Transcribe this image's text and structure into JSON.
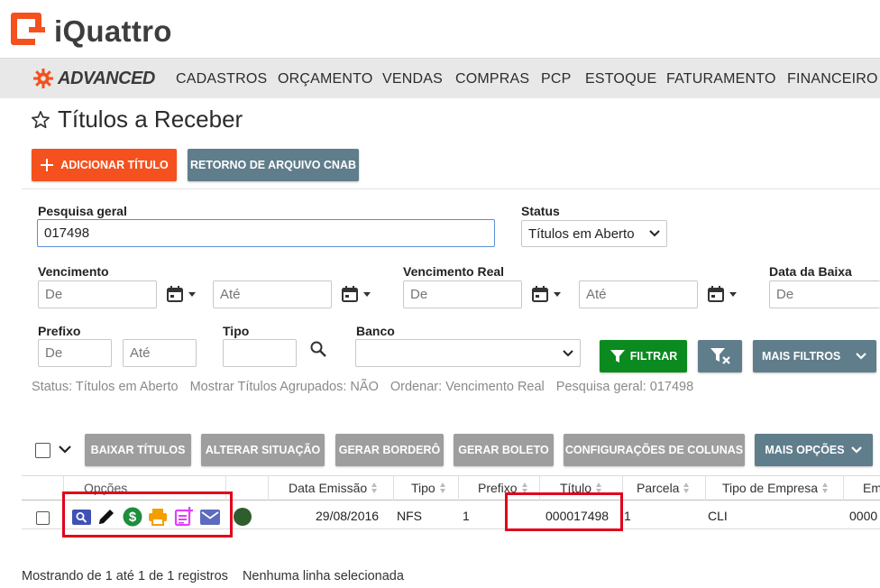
{
  "brand": {
    "name": "iQuattro",
    "edition": "ADVANCED",
    "accent": "#f4511e"
  },
  "menu": [
    "CADASTROS",
    "ORÇAMENTO",
    "VENDAS",
    "COMPRAS",
    "PCP",
    "ESTOQUE",
    "FATURAMENTO",
    "FINANCEIRO"
  ],
  "page_title": "Títulos a Receber",
  "actions": {
    "add_label": "ADICIONAR TÍTULO",
    "cnab_label": "RETORNO DE ARQUIVO CNAB"
  },
  "filters": {
    "search_label": "Pesquisa geral",
    "search_value": "017498",
    "status_label": "Status",
    "status_value": "Títulos em Aberto",
    "vencimento_label": "Vencimento",
    "vencimento_real_label": "Vencimento Real",
    "data_baixa_label": "Data da Baixa",
    "prefixo_label": "Prefixo",
    "tipo_label": "Tipo",
    "banco_label": "Banco",
    "from_placeholder": "De",
    "to_placeholder": "Até",
    "filter_button": "FILTRAR",
    "more_filters_button": "MAIS FILTROS"
  },
  "summary": {
    "status": "Status: Títulos em Aberto",
    "agrupados": "Mostrar Títulos Agrupados: NÃO",
    "ordenar": "Ordenar: Vencimento Real",
    "pesquisa": "Pesquisa geral: 017498"
  },
  "toolbar": {
    "baixar": "BAIXAR TÍTULOS",
    "alterar": "ALTERAR SITUAÇÃO",
    "bordero": "GERAR BORDERÔ",
    "boleto": "GERAR BOLETO",
    "colunas": "CONFIGURAÇÕES DE COLUNAS",
    "mais_opcoes": "MAIS OPÇÕES"
  },
  "table": {
    "headers": {
      "opcoes": "Opções",
      "data_emissao": "Data Emissão",
      "tipo": "Tipo",
      "prefixo": "Prefixo",
      "titulo": "Título",
      "parcela": "Parcela",
      "tipo_empresa": "Tipo de Empresa",
      "empresa_partial": "Em"
    },
    "row": {
      "status_color": "#2e5e2e",
      "data_emissao": "29/08/2016",
      "tipo": "NFS",
      "prefixo": "1",
      "titulo": "000017498",
      "parcela": "1",
      "tipo_empresa": "CLI",
      "empresa_partial": "0000"
    },
    "row_icons": [
      "search-icon",
      "edit-pencil-icon",
      "dollar-icon",
      "print-icon",
      "note-add-icon",
      "mail-icon"
    ]
  },
  "footer": {
    "showing": "Mostrando de 1 até 1 de 1 registros",
    "selection": "Nenhuma linha selecionada"
  }
}
